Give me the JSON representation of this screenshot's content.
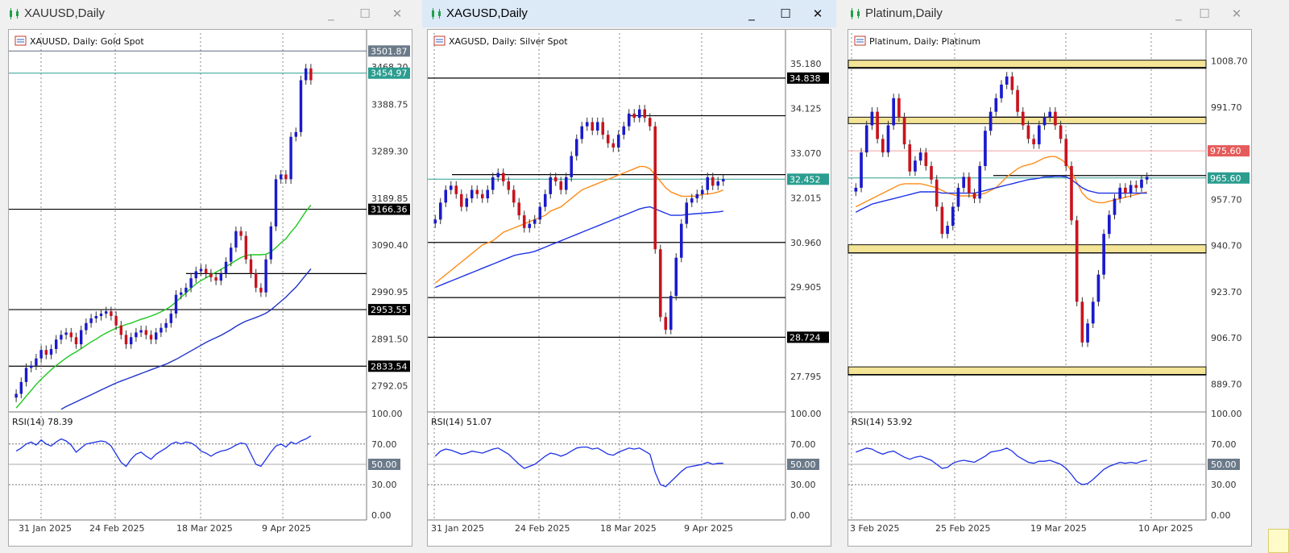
{
  "windows": [
    {
      "key": "gold",
      "title": "XAUUSD,Daily",
      "chart_label": "XAUUSD, Daily:  Gold Spot",
      "active": false
    },
    {
      "key": "silver",
      "title": "XAGUSD,Daily",
      "chart_label": "XAGUSD, Daily:  Silver Spot",
      "active": true
    },
    {
      "key": "platinum",
      "title": "Platinum,Daily",
      "chart_label": "Platinum, Daily:  Platinum",
      "active": false
    }
  ],
  "window_buttons": {
    "minimize": "_",
    "maximize": "☐",
    "close": "✕"
  },
  "chart_data": [
    {
      "type": "candlestick",
      "instrument": "XAUUSD",
      "timeframe": "Daily",
      "title": "XAUUSD, Daily:  Gold Spot",
      "ylim": [
        2740,
        3540
      ],
      "yticks": [
        "3388.75",
        "3289.30",
        "3189.85",
        "3090.40",
        "2990.95",
        "2891.50",
        "2792.05"
      ],
      "xticks": [
        "31 Jan 2025",
        "24 Feb 2025",
        "18 Mar 2025",
        "9 Apr 2025"
      ],
      "price_labels": [
        {
          "value": 3501.87,
          "text": "3501.87",
          "kind": "high"
        },
        {
          "value": 3454.97,
          "text": "3454.97",
          "kind": "bid"
        },
        {
          "value": 3166.36,
          "text": "3166.36",
          "kind": "level"
        },
        {
          "value": 2953.55,
          "text": "2953.55",
          "kind": "level"
        },
        {
          "value": 2833.54,
          "text": "2833.54",
          "kind": "level"
        }
      ],
      "partial_tick": "3468.20",
      "horizontal_levels": [
        3166.36,
        3030,
        2953.55,
        2833.54
      ],
      "colors": {
        "up": "#1a1acd",
        "down": "#c8141e",
        "ma_fast": "#1ec81e",
        "ma_slow": "#1e32c8",
        "ma_long": "#dc1414",
        "bid": "#2a9d8f",
        "high": "#6b7a89"
      },
      "series": [
        {
          "name": "Close",
          "values": [
            2775,
            2800,
            2830,
            2835,
            2850,
            2868,
            2858,
            2870,
            2890,
            2900,
            2905,
            2895,
            2880,
            2910,
            2925,
            2935,
            2940,
            2945,
            2950,
            2940,
            2920,
            2900,
            2880,
            2895,
            2905,
            2910,
            2900,
            2890,
            2905,
            2915,
            2925,
            2945,
            2985,
            2990,
            3000,
            3020,
            3035,
            3040,
            3030,
            3022,
            3015,
            3030,
            3055,
            3085,
            3120,
            3110,
            3060,
            3030,
            3000,
            2990,
            3060,
            3130,
            3230,
            3240,
            3230,
            3320,
            3330,
            3440,
            3465,
            3440
          ]
        },
        {
          "name": "MA fast",
          "values": [
            2745,
            2757,
            2770,
            2782,
            2795,
            2806,
            2816,
            2826,
            2835,
            2843,
            2851,
            2858,
            2864,
            2871,
            2878,
            2885,
            2891,
            2898,
            2904,
            2909,
            2914,
            2918,
            2922,
            2925,
            2929,
            2933,
            2936,
            2940,
            2944,
            2949,
            2954,
            2961,
            2970,
            2980,
            2989,
            2999,
            3008,
            3015,
            3021,
            3027,
            3033,
            3039,
            3045,
            3051,
            3058,
            3064,
            3068,
            3070,
            3070,
            3070,
            3071,
            3076,
            3085,
            3095,
            3104,
            3118,
            3130,
            3146,
            3162,
            3175
          ]
        },
        {
          "name": "MA slow",
          "values": [
            2690,
            2695,
            2701,
            2707,
            2713,
            2719,
            2725,
            2731,
            2736,
            2742,
            2748,
            2753,
            2758,
            2763,
            2768,
            2773,
            2778,
            2783,
            2788,
            2793,
            2798,
            2802,
            2806,
            2810,
            2814,
            2818,
            2822,
            2826,
            2830,
            2834,
            2838,
            2843,
            2848,
            2854,
            2860,
            2866,
            2872,
            2878,
            2884,
            2889,
            2894,
            2899,
            2905,
            2911,
            2918,
            2924,
            2929,
            2933,
            2937,
            2941,
            2946,
            2953,
            2962,
            2971,
            2980,
            2991,
            3001,
            3014,
            3027,
            3040
          ]
        },
        {
          "name": "MA long",
          "values": [
            2600,
            2600,
            2600,
            2600,
            2600,
            2600,
            2600,
            2600,
            2600,
            2600,
            2600,
            2600,
            2600,
            2600,
            2600,
            2600,
            2600,
            2600,
            2600,
            2600,
            2600,
            2600,
            2600,
            2600,
            2600,
            2600,
            2600,
            2600,
            2600,
            2600,
            2600,
            2600,
            2600,
            2600,
            2600,
            2600,
            2600,
            2600,
            2600,
            2600,
            2600,
            2600,
            2600,
            2600,
            2600,
            2600,
            2600,
            2600,
            2700,
            2703,
            2706,
            2709,
            2712,
            2715,
            2718,
            2721,
            2724,
            2727,
            2730,
            2733
          ]
        }
      ],
      "rsi": {
        "label": "RSI(14) 78.39",
        "ylim": [
          0,
          100
        ],
        "yticks": [
          "100.00",
          "70.00",
          "30.00",
          "0.00"
        ],
        "level_label": "50.00",
        "values": [
          63,
          66,
          70,
          72,
          69,
          74,
          70,
          68,
          72,
          75,
          73,
          69,
          62,
          66,
          70,
          71,
          72,
          73,
          72,
          68,
          60,
          52,
          48,
          55,
          60,
          62,
          58,
          55,
          60,
          63,
          66,
          70,
          72,
          70,
          72,
          71,
          68,
          63,
          61,
          58,
          61,
          63,
          64,
          66,
          69,
          71,
          70,
          60,
          50,
          48,
          55,
          62,
          68,
          70,
          67,
          72,
          70,
          73,
          75,
          78
        ]
      }
    },
    {
      "type": "candlestick",
      "instrument": "XAGUSD",
      "timeframe": "Daily",
      "title": "XAGUSD, Daily:  Silver Spot",
      "ylim": [
        27.0,
        35.9
      ],
      "yticks": [
        "35.180",
        "34.125",
        "33.070",
        "32.015",
        "30.960",
        "29.905",
        "27.795"
      ],
      "xticks": [
        "31 Jan 2025",
        "24 Feb 2025",
        "18 Mar 2025",
        "9 Apr 2025"
      ],
      "price_labels": [
        {
          "value": 34.838,
          "text": "34.838",
          "kind": "level"
        },
        {
          "value": 32.452,
          "text": "32.452",
          "kind": "bid"
        },
        {
          "value": 28.724,
          "text": "28.724",
          "kind": "level"
        }
      ],
      "horizontal_levels": [
        34.838,
        33.95,
        32.56,
        30.96,
        29.66,
        28.724
      ],
      "colors": {
        "up": "#1a1acd",
        "down": "#c8141e",
        "ma_fast": "#ff8c1a",
        "ma_slow": "#1e32e6",
        "bid": "#2a9d8f"
      },
      "series": [
        {
          "name": "Close",
          "values": [
            31.5,
            31.9,
            32.2,
            32.3,
            32.1,
            31.8,
            32.0,
            32.2,
            32.1,
            32.0,
            32.2,
            32.5,
            32.6,
            32.4,
            32.2,
            31.9,
            31.6,
            31.3,
            31.4,
            31.5,
            31.8,
            32.1,
            32.5,
            32.4,
            32.2,
            32.5,
            33.0,
            33.4,
            33.7,
            33.8,
            33.6,
            33.8,
            33.5,
            33.3,
            33.2,
            33.5,
            33.7,
            34.0,
            33.9,
            34.1,
            33.9,
            33.7,
            30.8,
            29.2,
            28.9,
            29.7,
            30.6,
            31.4,
            31.9,
            32.0,
            32.1,
            32.2,
            32.5,
            32.3,
            32.4,
            32.45
          ]
        },
        {
          "name": "MA fast",
          "values": [
            30.0,
            30.1,
            30.2,
            30.3,
            30.4,
            30.5,
            30.6,
            30.7,
            30.8,
            30.9,
            30.95,
            31.0,
            31.1,
            31.2,
            31.25,
            31.3,
            31.35,
            31.4,
            31.45,
            31.5,
            31.55,
            31.6,
            31.7,
            31.75,
            31.8,
            31.9,
            32.0,
            32.1,
            32.2,
            32.25,
            32.3,
            32.35,
            32.4,
            32.45,
            32.5,
            32.55,
            32.6,
            32.65,
            32.7,
            32.75,
            32.75,
            32.7,
            32.55,
            32.4,
            32.25,
            32.15,
            32.1,
            32.05,
            32.05,
            32.05,
            32.05,
            32.1,
            32.1,
            32.12,
            32.15,
            32.2
          ]
        },
        {
          "name": "MA slow",
          "values": [
            29.9,
            29.95,
            30.0,
            30.05,
            30.1,
            30.15,
            30.2,
            30.25,
            30.3,
            30.35,
            30.4,
            30.45,
            30.5,
            30.55,
            30.6,
            30.65,
            30.68,
            30.7,
            30.72,
            30.75,
            30.8,
            30.85,
            30.9,
            30.95,
            31.0,
            31.05,
            31.1,
            31.15,
            31.2,
            31.25,
            31.3,
            31.35,
            31.4,
            31.45,
            31.5,
            31.55,
            31.6,
            31.65,
            31.7,
            31.75,
            31.78,
            31.8,
            31.75,
            31.7,
            31.65,
            31.6,
            31.6,
            31.6,
            31.62,
            31.63,
            31.64,
            31.65,
            31.66,
            31.67,
            31.68,
            31.7
          ]
        }
      ],
      "rsi": {
        "label": "RSI(14) 51.07",
        "ylim": [
          0,
          100
        ],
        "yticks": [
          "100.00",
          "70.00",
          "30.00",
          "0.00"
        ],
        "level_label": "50.00",
        "values": [
          58,
          63,
          65,
          64,
          62,
          60,
          61,
          63,
          62,
          61,
          63,
          65,
          66,
          63,
          60,
          55,
          50,
          46,
          48,
          50,
          54,
          58,
          61,
          60,
          58,
          60,
          63,
          66,
          67,
          67,
          65,
          66,
          63,
          60,
          59,
          62,
          64,
          66,
          65,
          66,
          63,
          60,
          42,
          30,
          28,
          33,
          38,
          43,
          47,
          48,
          49,
          50,
          52,
          50,
          51,
          51
        ]
      }
    },
    {
      "type": "candlestick",
      "instrument": "Platinum",
      "timeframe": "Daily",
      "title": "Platinum, Daily:  Platinum",
      "ylim": [
        880,
        1019
      ],
      "yticks": [
        "1008.70",
        "991.70",
        "957.70",
        "940.70",
        "923.70",
        "906.70",
        "889.70"
      ],
      "xticks": [
        "3 Feb 2025",
        "25 Feb 2025",
        "19 Mar 2025",
        "10 Apr 2025"
      ],
      "price_labels": [
        {
          "value": 975.6,
          "text": "975.60",
          "kind": "ask"
        },
        {
          "value": 965.6,
          "text": "965.60",
          "kind": "bid"
        }
      ],
      "zones": [
        [
          1006,
          1009
        ],
        [
          986,
          988
        ],
        [
          938,
          941
        ],
        [
          893,
          896
        ]
      ],
      "horizontal_levels": [
        1006.3,
        988,
        966.5,
        938,
        893.2
      ],
      "colors": {
        "up": "#1a1acd",
        "down": "#c8141e",
        "ma_fast": "#ff8c1a",
        "ma_slow": "#1e32e6",
        "zone": "#f3e496",
        "bid": "#2a9d8f",
        "ask": "#e55b5b"
      },
      "series": [
        {
          "name": "Close",
          "values": [
            962,
            975,
            985,
            990,
            980,
            975,
            985,
            995,
            988,
            978,
            968,
            972,
            975,
            970,
            965,
            955,
            945,
            948,
            955,
            962,
            966,
            960,
            958,
            970,
            983,
            990,
            995,
            1000,
            1003,
            998,
            990,
            985,
            980,
            978,
            985,
            988,
            990,
            985,
            980,
            970,
            950,
            920,
            905,
            912,
            920,
            930,
            945,
            952,
            958,
            962,
            960,
            963,
            962,
            965,
            966
          ]
        },
        {
          "name": "MA fast",
          "values": [
            955,
            956,
            957,
            958,
            959,
            960,
            961,
            962,
            963,
            963.5,
            963.5,
            963.5,
            963.5,
            963,
            962.5,
            962,
            961,
            960,
            959.5,
            959,
            959,
            959,
            959,
            959.5,
            960,
            961,
            962,
            964,
            966,
            967.5,
            969,
            970,
            970.5,
            971,
            972,
            973,
            973.5,
            973.5,
            972.5,
            971,
            968,
            964,
            960,
            958,
            957,
            956.5,
            956.5,
            957,
            957.5,
            958,
            958.5,
            959,
            959.5,
            960,
            960.5
          ]
        },
        {
          "name": "MA slow",
          "values": [
            953,
            954,
            955,
            956,
            956.5,
            957,
            957.5,
            958,
            958.5,
            959,
            959.5,
            960,
            960.5,
            960.5,
            960.5,
            960.5,
            960,
            960,
            960,
            960,
            960,
            960,
            960,
            960.5,
            961,
            961.5,
            962,
            962.5,
            963,
            963.5,
            964,
            964.5,
            965,
            965.2,
            965.5,
            966,
            966,
            966.2,
            966.2,
            966,
            965,
            963.5,
            962,
            961,
            960.5,
            960,
            960,
            960,
            960,
            960,
            960,
            960,
            960,
            960,
            960
          ]
        }
      ],
      "rsi": {
        "label": "RSI(14) 53.92",
        "ylim": [
          0,
          100
        ],
        "yticks": [
          "100.00",
          "70.00",
          "30.00",
          "0.00"
        ],
        "level_label": "50.00",
        "values": [
          62,
          64,
          66,
          65,
          62,
          60,
          62,
          63,
          60,
          57,
          55,
          57,
          58,
          56,
          54,
          50,
          46,
          47,
          51,
          53,
          54,
          53,
          52,
          55,
          58,
          62,
          63,
          64,
          66,
          63,
          58,
          55,
          52,
          51,
          53,
          53,
          54,
          52,
          50,
          46,
          40,
          33,
          30,
          31,
          35,
          40,
          45,
          48,
          50,
          52,
          51,
          52,
          51,
          53,
          54
        ]
      }
    }
  ]
}
